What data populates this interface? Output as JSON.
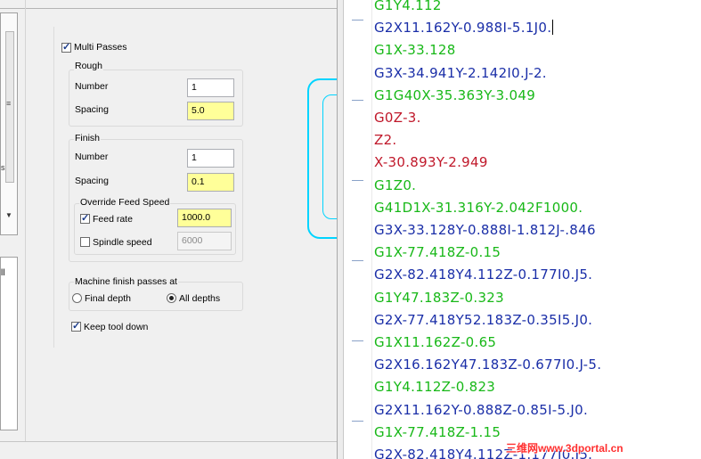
{
  "left_strip": {
    "stray_char": "s",
    "stray_char2": "ll"
  },
  "dialog": {
    "multi_passes_label": "Multi Passes",
    "rough": {
      "title": "Rough",
      "number_label": "Number",
      "number_value": "1",
      "spacing_label": "Spacing",
      "spacing_value": "5.0"
    },
    "finish": {
      "title": "Finish",
      "number_label": "Number",
      "number_value": "1",
      "spacing_label": "Spacing",
      "spacing_value": "0.1",
      "override": {
        "title": "Override Feed Speed",
        "feed_rate_label": "Feed rate",
        "feed_rate_value": "1000.0",
        "spindle_speed_label": "Spindle speed",
        "spindle_speed_value": "6000"
      }
    },
    "machine_finish": {
      "title": "Machine finish passes at",
      "final_depth_label": "Final depth",
      "all_depths_label": "All depths"
    },
    "keep_tool_down_label": "Keep tool down"
  },
  "editor": {
    "lines": [
      {
        "text": "G1Y4.112",
        "color": "green"
      },
      {
        "text": "G2X11.162Y-0.988I-5.1J0.",
        "color": "blue"
      },
      {
        "text": "G1X-33.128",
        "color": "green"
      },
      {
        "text": "G3X-34.941Y-2.142I0.J-2.",
        "color": "blue"
      },
      {
        "text": "G1G40X-35.363Y-3.049",
        "color": "green"
      },
      {
        "text": "G0Z-3.",
        "color": "red"
      },
      {
        "text": "Z2.",
        "color": "red"
      },
      {
        "text": "X-30.893Y-2.949",
        "color": "red"
      },
      {
        "text": "G1Z0.",
        "color": "green"
      },
      {
        "text": "G41D1X-31.316Y-2.042F1000.",
        "color": "green"
      },
      {
        "text": "G3X-33.128Y-0.888I-1.812J-.846",
        "color": "blue"
      },
      {
        "text": "G1X-77.418Z-0.15",
        "color": "green"
      },
      {
        "text": "G2X-82.418Y4.112Z-0.177I0.J5.",
        "color": "blue"
      },
      {
        "text": "G1Y47.183Z-0.323",
        "color": "green"
      },
      {
        "text": "G2X-77.418Y52.183Z-0.35I5.J0.",
        "color": "blue"
      },
      {
        "text": "G1X11.162Z-0.65",
        "color": "green"
      },
      {
        "text": "G2X16.162Y47.183Z-0.677I0.J-5.",
        "color": "blue"
      },
      {
        "text": "G1Y4.112Z-0.823",
        "color": "green"
      },
      {
        "text": "G2X11.162Y-0.888Z-0.85I-5.J0.",
        "color": "blue"
      },
      {
        "text": "G1X-77.418Z-1.15",
        "color": "green"
      },
      {
        "text": "G2X-82.418Y4.112Z-1.177I0.J5.",
        "color": "blue"
      }
    ]
  },
  "colors": {
    "green": "#18b818",
    "blue": "#1b2fa8",
    "red": "#c0182a",
    "preview_outline": "#00d4ff",
    "highlight_field": "#ffff99"
  },
  "watermark": "三维网www.3dportal.cn"
}
